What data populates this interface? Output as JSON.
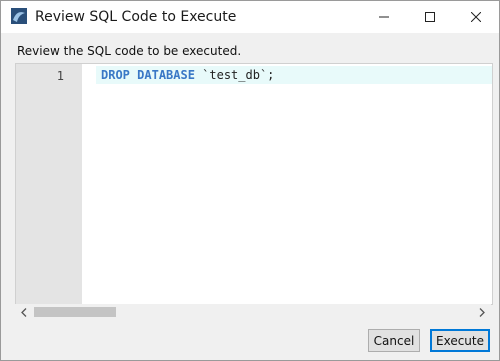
{
  "window": {
    "title": "Review SQL Code to Execute"
  },
  "dialog": {
    "prompt": "Review the SQL code to be executed."
  },
  "editor": {
    "line_number": "1",
    "code_keyword_1": "DROP",
    "code_keyword_2": "DATABASE",
    "code_rest": " `test_db`;"
  },
  "buttons": {
    "cancel": "Cancel",
    "execute": "Execute"
  },
  "colors": {
    "keyword": "#3a78c6",
    "current_line": "#e8fafa",
    "gutter": "#e4e4e4",
    "default_button_border": "#0078d7"
  },
  "icons": {
    "app": "mysql-workbench-icon",
    "minimize": "minimize-icon",
    "maximize": "maximize-icon",
    "close": "close-icon",
    "scroll_left": "chevron-left-icon",
    "scroll_right": "chevron-right-icon"
  }
}
